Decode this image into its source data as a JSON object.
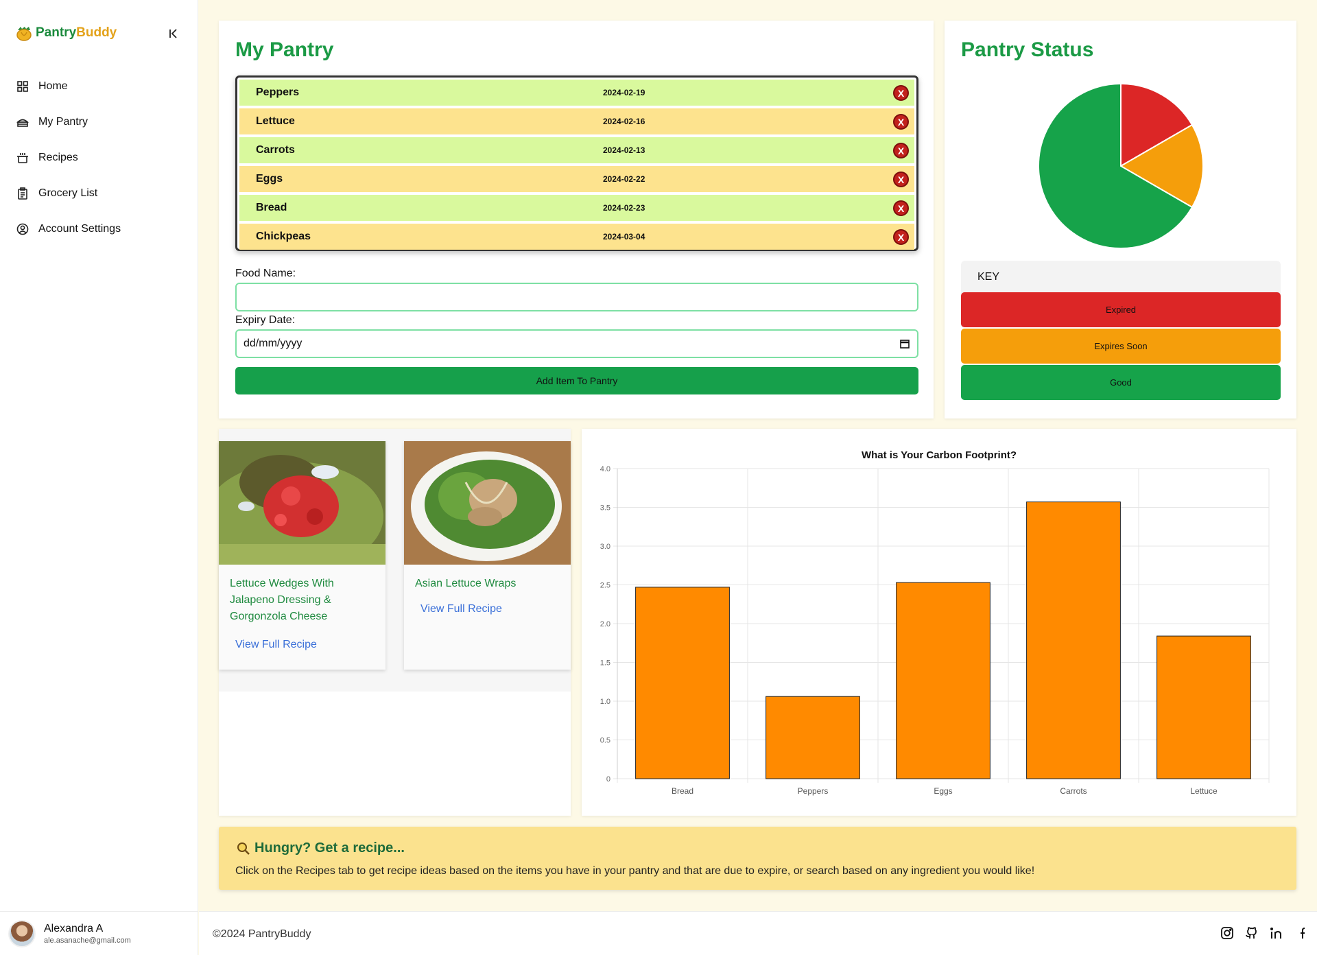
{
  "app": {
    "brand_part1": "Pantry",
    "brand_part2": "Buddy"
  },
  "sidebar": {
    "items": [
      {
        "label": "Home",
        "icon": "grid-icon"
      },
      {
        "label": "My Pantry",
        "icon": "pantry-icon"
      },
      {
        "label": "Recipes",
        "icon": "pot-icon"
      },
      {
        "label": "Grocery List",
        "icon": "clipboard-icon"
      },
      {
        "label": "Account Settings",
        "icon": "user-circle-icon"
      }
    ],
    "user": {
      "name": "Alexandra A",
      "email": "ale.asanache@gmail.com"
    }
  },
  "pantry": {
    "title": "My Pantry",
    "items": [
      {
        "name": "Peppers",
        "date": "2024-02-19",
        "color": "#d9f99d"
      },
      {
        "name": "Lettuce",
        "date": "2024-02-16",
        "color": "#fde38e"
      },
      {
        "name": "Carrots",
        "date": "2024-02-13",
        "color": "#d9f99d"
      },
      {
        "name": "Eggs",
        "date": "2024-02-22",
        "color": "#fde38e"
      },
      {
        "name": "Bread",
        "date": "2024-02-23",
        "color": "#d9f99d"
      },
      {
        "name": "Chickpeas",
        "date": "2024-03-04",
        "color": "#fde38e"
      }
    ],
    "remove_label": "X",
    "food_name_label": "Food Name:",
    "food_name_value": "",
    "expiry_label": "Expiry Date:",
    "expiry_placeholder": "dd/mm/yyyy",
    "add_button": "Add Item To Pantry"
  },
  "status": {
    "title": "Pantry Status",
    "pie": [
      {
        "label": "Expired",
        "value": 1,
        "color": "#dc2626"
      },
      {
        "label": "Expires Soon",
        "value": 1,
        "color": "#f59e0b"
      },
      {
        "label": "Good",
        "value": 4,
        "color": "#16a34a"
      }
    ],
    "key_title": "KEY",
    "key": [
      {
        "label": "Expired",
        "color": "#dc2626"
      },
      {
        "label": "Expires Soon",
        "color": "#f59e0b"
      },
      {
        "label": "Good",
        "color": "#16a34a"
      }
    ]
  },
  "recipes": [
    {
      "title": "Lettuce Wedges With Jalapeno Dressing & Gorgonzola Cheese",
      "link": "View Full Recipe"
    },
    {
      "title": "Asian Lettuce Wraps",
      "link": "View Full Recipe"
    }
  ],
  "chart_data": {
    "type": "bar",
    "title": "What is Your Carbon Footprint?",
    "categories": [
      "Bread",
      "Peppers",
      "Eggs",
      "Carrots",
      "Lettuce"
    ],
    "values": [
      2.47,
      1.06,
      2.53,
      3.57,
      1.84
    ],
    "ylim": [
      0,
      4
    ],
    "yticks": [
      "0",
      "0.5",
      "1.0",
      "1.5",
      "2.0",
      "2.5",
      "3.0",
      "3.5",
      "4.0"
    ],
    "bar_color": "#ff8a00",
    "grid": true
  },
  "hungry": {
    "title": "Hungry? Get a recipe...",
    "text": "Click on the Recipes tab to get recipe ideas based on the items you have in your pantry and that are due to expire, or search based on any ingredient you would like!"
  },
  "footer": {
    "copyright": "©2024 PantryBuddy"
  }
}
